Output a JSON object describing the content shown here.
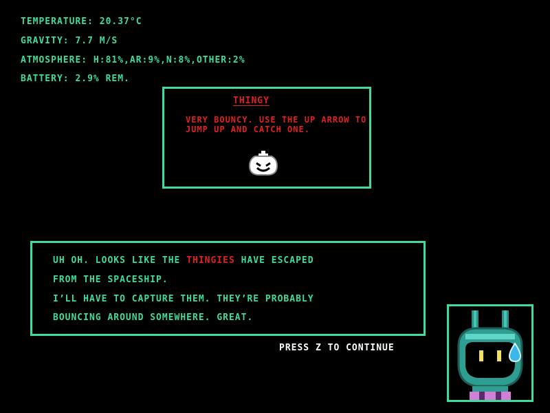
{
  "stats": {
    "temperature": "TEMPERATURE: 20.37°C",
    "gravity": "GRAVITY: 7.7 M/S",
    "atmosphere": "ATMOSPHERE: H:81%,AR:9%,N:8%,OTHER:2%",
    "battery": "BATTERY: 2.9% REM."
  },
  "item_card": {
    "title": "THINGY",
    "description": "VERY BOUNCY. USE THE UP ARROW TO JUMP UP AND CATCH ONE.",
    "sprite_icon": "thingy-blob-icon"
  },
  "dialog": {
    "line1_pre": "UH OH. LOOKS LIKE THE ",
    "line1_highlight": "THINGIES",
    "line1_post": " HAVE ESCAPED",
    "line2": "FROM THE SPACESHIP.",
    "line3": "I’LL HAVE TO CAPTURE THEM. THEY’RE PROBABLY",
    "line4": "BOUNCING AROUND SOMEWHERE. GREAT."
  },
  "prompt": {
    "continue": "PRESS Z TO CONTINUE"
  },
  "speaker": {
    "icon": "robot-alien-portrait-icon"
  },
  "colors": {
    "accent": "#3fdc9c",
    "highlight": "#e02020",
    "prompt": "#ffffff",
    "background": "#000000"
  }
}
